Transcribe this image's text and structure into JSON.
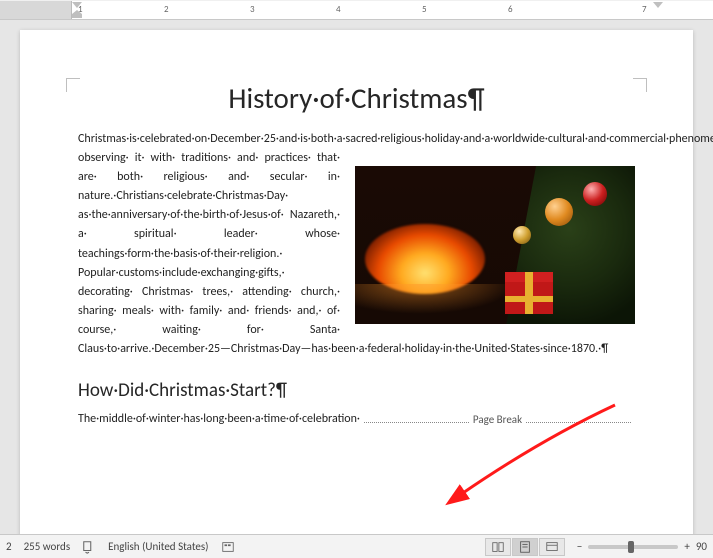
{
  "ruler": {
    "numbers": [
      "1",
      "2",
      "3",
      "4",
      "5",
      "6",
      "7"
    ]
  },
  "document": {
    "title": "History·of·Christmas¶",
    "para_top": "Christmas·is·celebrated·on·December·25·and·is·both·a·sacred·religious·holiday·and·a·worldwide·cultural·and·commercial·phenomenon.·For·two·millennia,·people·around·the·world·have·been·",
    "para_wrap": "observing· it· with· traditions· and· practices· that· are· both· religious· and· secular· in· nature.·Christians·celebrate·Christmas·Day· as·the·anniversary·of·the·birth·of·Jesus·of· Nazareth,· a· spiritual· leader· whose· teachings·form·the·basis·of·their·religion.· Popular·customs·include·exchanging·gifts,· decorating· Christmas· trees,· attending· church,· sharing· meals· with· family· and· friends· and,· of· course,· waiting· for· Santa·",
    "para_bottom": "Claus·to·arrive.·December·25—Christmas·Day—has·been·a·federal·holiday·in·the·United·States·since·1870.·¶",
    "heading2": "How·Did·Christmas·Start?¶",
    "last_line_text": "The·middle·of·winter·has·long·been·a·time·of·celebration·",
    "page_break_label": "Page Break"
  },
  "statusbar": {
    "page_num": "2",
    "word_count": "255 words",
    "language": "English (United States)",
    "zoom_value": "90",
    "minus": "−",
    "plus": "+"
  }
}
